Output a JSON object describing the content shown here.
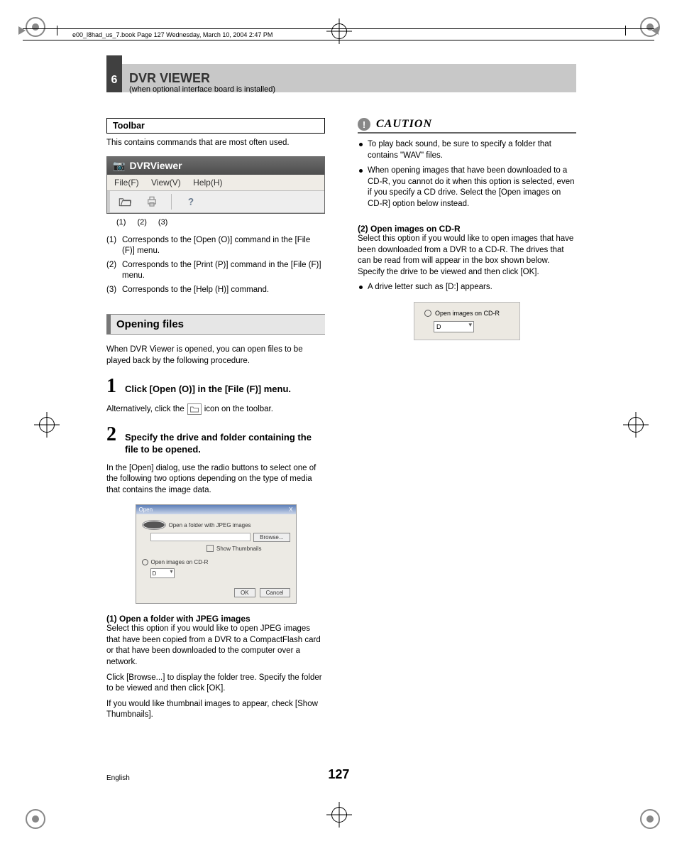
{
  "header_line": "e00_l8had_us_7.book  Page 127  Wednesday, March 10, 2004  2:47 PM",
  "chapter": {
    "num": "6",
    "title": "DVR VIEWER",
    "sub": "(when optional interface board is installed)"
  },
  "left": {
    "toolbar_label": "Toolbar",
    "toolbar_desc": "This contains commands that are most often used.",
    "app": {
      "title": "DVRViewer",
      "menus": {
        "file": "File(F)",
        "view": "View(V)",
        "help": "Help(H)"
      },
      "callouts": {
        "c1": "(1)",
        "c2": "(2)",
        "c3": "(3)"
      }
    },
    "toolbar_items": {
      "i1n": "(1)",
      "i1": "Corresponds to the [Open (O)] command in the [File (F)] menu.",
      "i2n": "(2)",
      "i2": "Corresponds to the [Print (P)] command in the [File (F)] menu.",
      "i3n": "(3)",
      "i3": "Corresponds to the [Help (H)] command."
    },
    "section_opening": "Opening files",
    "opening_intro": "When DVR Viewer is opened, you can open files to be played back by the following procedure.",
    "step1": {
      "num": "1",
      "title": "Click [Open (O)] in the [File (F)] menu.",
      "alt_a": "Alternatively, click the",
      "alt_b": "icon on the toolbar."
    },
    "step2": {
      "num": "2",
      "title": "Specify the drive and folder containing the file to be opened."
    },
    "step2_body": "In the [Open] dialog, use the radio buttons to select one of the following two options depending on the type of media that contains the image data.",
    "dialog": {
      "title": "Open",
      "close": "X",
      "opt1": "Open a folder with JPEG images",
      "browse": "Browse...",
      "show_thumb": "Show Thumbnails",
      "opt2": "Open images on CD-R",
      "drive": "D",
      "ok": "OK",
      "cancel": "Cancel"
    },
    "sub1_head": "(1)  Open a folder with JPEG images",
    "sub1_a": "Select this option if you would like to open JPEG images that have been copied from a DVR to a CompactFlash card or that have been downloaded to the computer over a network.",
    "sub1_b": "Click [Browse...] to display the folder tree. Specify the folder to be viewed and then click [OK].",
    "sub1_c": "If you would like thumbnail images to appear, check [Show Thumbnails]."
  },
  "right": {
    "caution_label": "CAUTION",
    "caution1": "To play back sound, be sure to specify a folder that contains \"WAV\" files.",
    "caution2": "When opening images that have been downloaded to a CD-R, you cannot do it when this option is selected, even if you specify a CD drive. Select the [Open images on CD-R] option below instead.",
    "sub2_head": "(2)  Open images on CD-R",
    "sub2_body": "Select this option if you would like to open images that have been downloaded from a DVR to a CD-R. The drives that can be read from will appear in the box shown below. Specify the drive to be viewed and then click [OK].",
    "sub2_bullet": "A drive letter such as [D:] appears.",
    "panel": {
      "label": "Open images on CD-R",
      "drive": "D"
    }
  },
  "footer": {
    "lang": "English",
    "page": "127"
  }
}
